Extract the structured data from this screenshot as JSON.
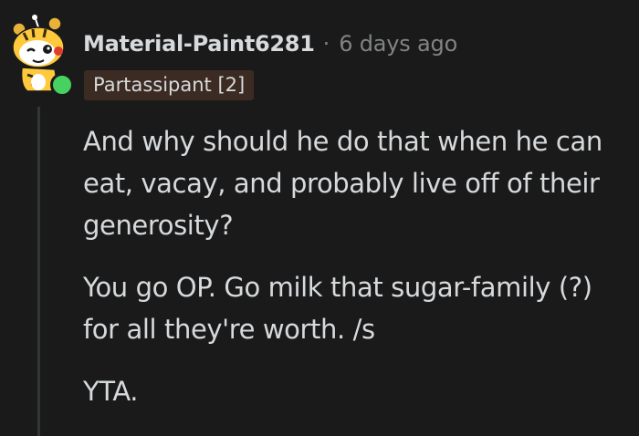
{
  "comment": {
    "username": "Material-Paint6281",
    "separator": "·",
    "time": "6 days ago",
    "flair": "Partassipant [2]",
    "paragraphs": [
      "And why should he do that when he can eat, vacay, and probably live off of their generosity?",
      "You go OP. Go milk that sugar-family (?) for all they're worth. /s",
      "YTA."
    ],
    "avatar_icon": "snoo-tiger-avatar-icon",
    "online_status_color": "#46d160",
    "flair_bg_color": "#3b2b22"
  }
}
